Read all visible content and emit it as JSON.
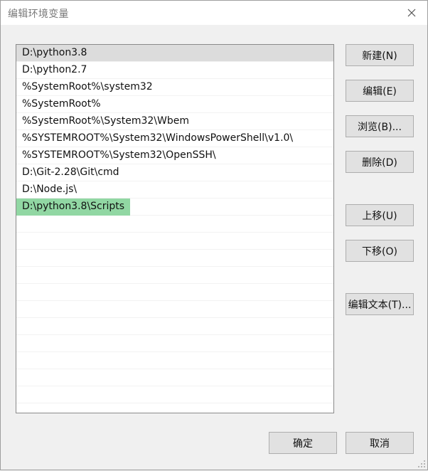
{
  "window": {
    "title": "编辑环境变量",
    "close_icon": "close-icon"
  },
  "path_list": {
    "items": [
      {
        "value": "D:\\python3.8",
        "selected": true
      },
      {
        "value": "D:\\python2.7"
      },
      {
        "value": "%SystemRoot%\\system32"
      },
      {
        "value": "%SystemRoot%"
      },
      {
        "value": "%SystemRoot%\\System32\\Wbem"
      },
      {
        "value": "%SYSTEMROOT%\\System32\\WindowsPowerShell\\v1.0\\"
      },
      {
        "value": "%SYSTEMROOT%\\System32\\OpenSSH\\"
      },
      {
        "value": "D:\\Git-2.28\\Git\\cmd"
      },
      {
        "value": "D:\\Node.js\\"
      },
      {
        "value": "D:\\python3.8\\Scripts",
        "editing": true
      }
    ],
    "selection_color": "#dcdcdc",
    "edit_highlight_color": "#91d7a3"
  },
  "buttons": {
    "new": "新建(N)",
    "edit": "编辑(E)",
    "browse": "浏览(B)...",
    "delete": "删除(D)",
    "move_up": "上移(U)",
    "move_down": "下移(O)",
    "edit_text": "编辑文本(T)...",
    "ok": "确定",
    "cancel": "取消"
  }
}
